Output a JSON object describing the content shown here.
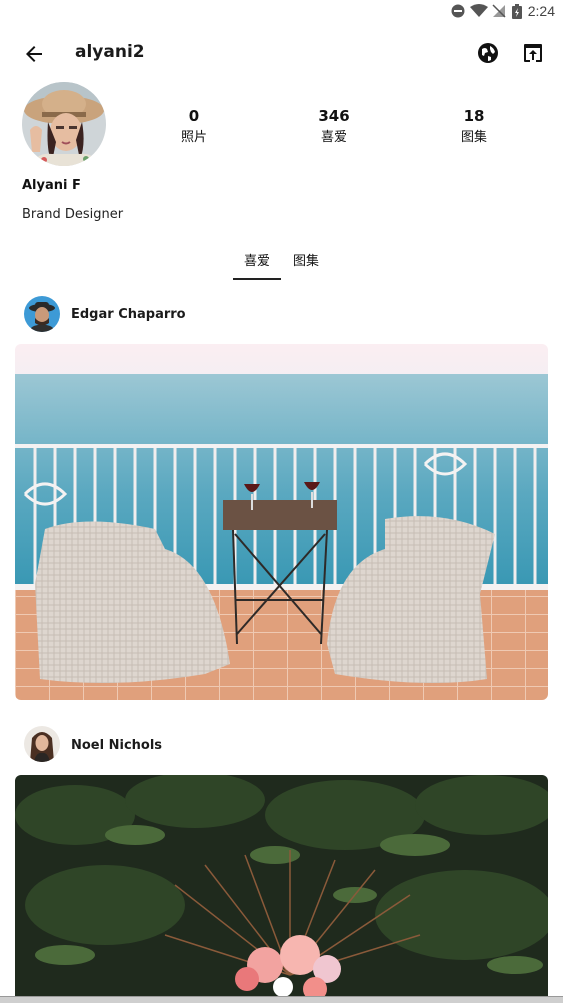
{
  "status_bar": {
    "time": "2:24"
  },
  "header": {
    "username": "alyani2"
  },
  "profile": {
    "display_name": "Alyani F",
    "bio": "Brand Designer"
  },
  "stats": [
    {
      "value": "0",
      "label": "照片"
    },
    {
      "value": "346",
      "label": "喜爱"
    },
    {
      "value": "18",
      "label": "图集"
    }
  ],
  "tabs": [
    {
      "label": "喜爱",
      "selected": true
    },
    {
      "label": "图集",
      "selected": false
    }
  ],
  "posts": [
    {
      "author": "Edgar Chaparro"
    },
    {
      "author": "Noel Nichols"
    }
  ],
  "icons": {
    "back": "arrow-back-icon",
    "web": "globe-icon",
    "open": "open-in-browser-icon"
  }
}
